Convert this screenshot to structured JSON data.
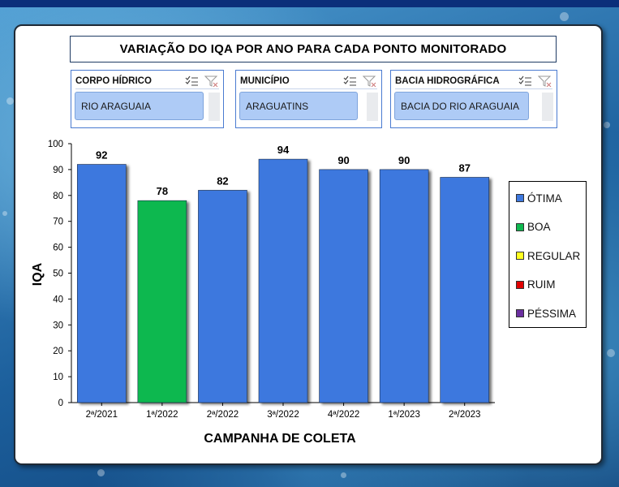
{
  "dashboard": {
    "title": "VARIAÇÃO DO IQA POR ANO PARA CADA PONTO MONITORADO"
  },
  "slicers": [
    {
      "header": "CORPO HÍDRICO",
      "selected": "RIO ARAGUAIA"
    },
    {
      "header": "MUNICÍPIO",
      "selected": "ARAGUATINS"
    },
    {
      "header": "BACIA HIDROGRÁFICA",
      "selected": "BACIA DO RIO ARAGUAIA"
    }
  ],
  "legend": [
    {
      "label": "ÓTIMA",
      "color": "#3d78de"
    },
    {
      "label": "BOA",
      "color": "#0fb84f"
    },
    {
      "label": "REGULAR",
      "color": "#ffff1f"
    },
    {
      "label": "RUIM",
      "color": "#e00000"
    },
    {
      "label": "PÉSSIMA",
      "color": "#6b2fa0"
    }
  ],
  "chart_data": {
    "type": "bar",
    "categories": [
      "2ª/2021",
      "1ª/2022",
      "2ª/2022",
      "3ª/2022",
      "4ª/2022",
      "1ª/2023",
      "2ª/2023"
    ],
    "values": [
      92,
      78,
      82,
      94,
      90,
      90,
      87
    ],
    "classes": [
      "ÓTIMA",
      "BOA",
      "ÓTIMA",
      "ÓTIMA",
      "ÓTIMA",
      "ÓTIMA",
      "ÓTIMA"
    ],
    "xlabel": "CAMPANHA DE COLETA",
    "ylabel": "IQA",
    "ylim": [
      0,
      100
    ],
    "yticks": [
      0,
      10,
      20,
      30,
      40,
      50,
      60,
      70,
      80,
      90,
      100
    ],
    "grid": false,
    "legend_position": "right"
  }
}
